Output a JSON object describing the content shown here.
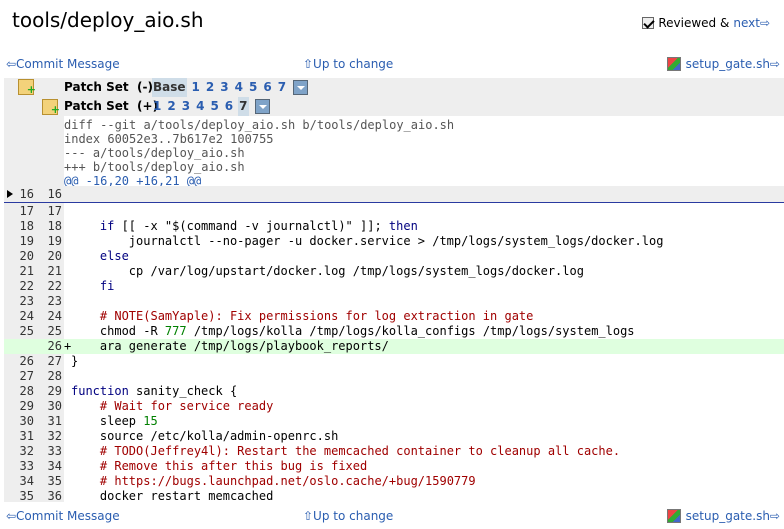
{
  "file": {
    "title": "tools/deploy_aio.sh"
  },
  "reviewed": {
    "label": "Reviewed &",
    "next": "next⇨",
    "checked": true
  },
  "nav": {
    "commit_message": "⇦Commit Message",
    "up_to_change": "⇧Up to change",
    "next_file": "setup_gate.sh⇨"
  },
  "patchsets": {
    "a": {
      "label": "Patch Set",
      "qual": "(-)",
      "items": [
        "Base",
        "1",
        "2",
        "3",
        "4",
        "5",
        "6",
        "7"
      ],
      "selected": "Base"
    },
    "b": {
      "label": "Patch Set",
      "qual": "(+)",
      "items": [
        "1",
        "2",
        "3",
        "4",
        "5",
        "6",
        "7"
      ],
      "selected": "7"
    }
  },
  "diff_header": [
    "diff --git a/tools/deploy_aio.sh b/tools/deploy_aio.sh",
    "index 60052e3..7b617e2 100755",
    "--- a/tools/deploy_aio.sh",
    "+++ b/tools/deploy_aio.sh",
    "@@ -16,20 +16,21 @@"
  ],
  "skip": {
    "a": "16",
    "b": "16"
  },
  "lines": [
    {
      "a": "17",
      "b": "17",
      "sign": "",
      "code": ""
    },
    {
      "a": "18",
      "b": "18",
      "sign": "",
      "code": "    if [[ -x \"$(command -v journalctl)\" ]]; then"
    },
    {
      "a": "19",
      "b": "19",
      "sign": "",
      "code": "        journalctl --no-pager -u docker.service > /tmp/logs/system_logs/docker.log"
    },
    {
      "a": "20",
      "b": "20",
      "sign": "",
      "code": "    else"
    },
    {
      "a": "21",
      "b": "21",
      "sign": "",
      "code": "        cp /var/log/upstart/docker.log /tmp/logs/system_logs/docker.log"
    },
    {
      "a": "22",
      "b": "22",
      "sign": "",
      "code": "    fi"
    },
    {
      "a": "23",
      "b": "23",
      "sign": "",
      "code": ""
    },
    {
      "a": "24",
      "b": "24",
      "sign": "",
      "code": "    # NOTE(SamYaple): Fix permissions for log extraction in gate"
    },
    {
      "a": "25",
      "b": "25",
      "sign": "",
      "code": "    chmod -R 777 /tmp/logs/kolla /tmp/logs/kolla_configs /tmp/logs/system_logs"
    },
    {
      "a": "",
      "b": "26",
      "sign": "+",
      "code": "    ara generate /tmp/logs/playbook_reports/"
    },
    {
      "a": "26",
      "b": "27",
      "sign": "",
      "code": "}"
    },
    {
      "a": "27",
      "b": "28",
      "sign": "",
      "code": ""
    },
    {
      "a": "28",
      "b": "29",
      "sign": "",
      "code": "function sanity_check {"
    },
    {
      "a": "29",
      "b": "30",
      "sign": "",
      "code": "    # Wait for service ready"
    },
    {
      "a": "30",
      "b": "31",
      "sign": "",
      "code": "    sleep 15"
    },
    {
      "a": "31",
      "b": "32",
      "sign": "",
      "code": "    source /etc/kolla/admin-openrc.sh"
    },
    {
      "a": "32",
      "b": "33",
      "sign": "",
      "code": "    # TODO(Jeffrey4l): Restart the memcached container to cleanup all cache."
    },
    {
      "a": "33",
      "b": "34",
      "sign": "",
      "code": "    # Remove this after this bug is fixed"
    },
    {
      "a": "34",
      "b": "35",
      "sign": "",
      "code": "    # https://bugs.launchpad.net/oslo.cache/+bug/1590779"
    },
    {
      "a": "35",
      "b": "36",
      "sign": "",
      "code": "    docker restart memcached"
    }
  ]
}
